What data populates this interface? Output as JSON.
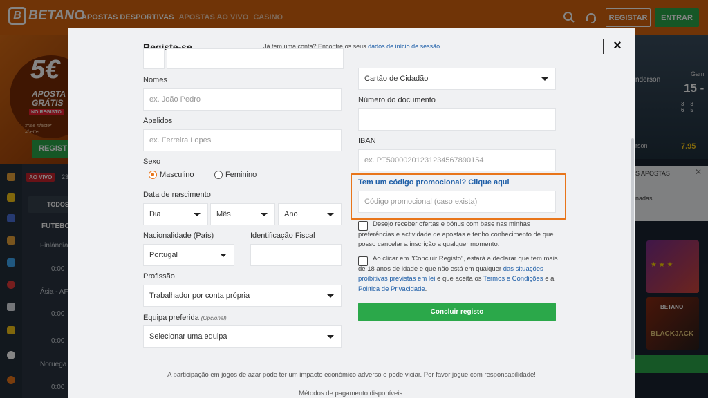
{
  "background": {
    "logo_mark": "B",
    "logo_text": "BETANO",
    "nav": [
      "APOSTAS DESPORTIVAS",
      "APOSTAS AO VIVO",
      "CASINO"
    ],
    "registar_label": "REGISTAR",
    "entrar_label": "ENTRAR",
    "promo": {
      "amount": "5€",
      "line1": "APOSTA",
      "line2": "GRÁTIS",
      "badge": "NO REGISTO",
      "tagline1": "#rise #faster",
      "tagline2": "#better",
      "button": "REGIST"
    },
    "live_badge": "AO VIVO",
    "live_count": "23",
    "todos_label": "TODOS",
    "mid_rows": [
      "FUTEBO",
      "Finlândia",
      "0:00",
      "Ásia - AF",
      "0:00",
      "0:00",
      "0:00",
      "Noruega",
      "0:00",
      "0:00"
    ],
    "right": {
      "player_name": "nderson",
      "game_label": "Gam",
      "score": "15 -",
      "grid": [
        "3",
        "3",
        "6",
        "5"
      ],
      "player2": "rson",
      "odd": "7.95",
      "panel_title": "S APOSTAS",
      "panel_text": "nadas",
      "game2_brand": "BETANO",
      "game2_title": "BLACKJACK"
    },
    "accent_orange": "#d6650f",
    "accent_green": "#2ba84a"
  },
  "modal": {
    "title": "Registe-se",
    "login_hint_text": "Já tem uma conta? Encontre os seus ",
    "login_hint_link": "dados de início de sessão",
    "login_hint_end": ".",
    "close_icon": "×",
    "left": {
      "nomes_label": "Nomes",
      "nomes_placeholder": "ex. João Pedro",
      "apelidos_label": "Apelidos",
      "apelidos_placeholder": "ex. Ferreira Lopes",
      "sexo_label": "Sexo",
      "sexo_options": [
        "Masculino",
        "Feminino"
      ],
      "sexo_selected": "Masculino",
      "nascimento_label": "Data de nascimento",
      "dia": "Dia",
      "mes": "Mês",
      "ano": "Ano",
      "nacionalidade_label": "Nacionalidade (País)",
      "nacionalidade_value": "Portugal",
      "nif_label": "Identificação Fiscal",
      "nif_value": "",
      "profissao_label": "Profissão",
      "profissao_value": "Trabalhador por conta própria",
      "equipa_label": "Equipa preferida",
      "equipa_optional": "(Opcional)",
      "equipa_value": "Selecionar uma equipa"
    },
    "right": {
      "documento_tipo_value": "Cartão de Cidadão",
      "documento_numero_label": "Número do documento",
      "documento_numero_value": "",
      "iban_label": "IBAN",
      "iban_placeholder": "ex. PT50000201231234567890154",
      "promo_link": "Tem um código promocional? Clique aqui",
      "promo_placeholder": "Código promocional (caso exista)",
      "consent_offers": "Desejo receber ofertas e bónus com base nas minhas preferências e actividade de apostas e tenho conhecimento de que posso cancelar a inscrição a qualquer momento.",
      "consent_terms_1": "Ao clicar em \"Concluir Registo\", estará a declarar que tem mais de 18 anos de idade e que não está em qualquer ",
      "consent_terms_link1": "das situações proibitivas previstas em lei",
      "consent_terms_2": " e que aceita os ",
      "consent_terms_link2": "Termos e Condições",
      "consent_terms_3": " e a ",
      "consent_terms_link3": "Política de Privacidade",
      "consent_terms_4": ".",
      "submit_label": "Concluir registo"
    },
    "disclaimer": "A participação em jogos de azar pode ter um impacto económico adverso e pode viciar. Por favor jogue com responsabilidade!",
    "payments_label": "Métodos de pagamento disponíveis:",
    "highlight_color": "#e8751a",
    "link_color": "#1f5fa8"
  }
}
